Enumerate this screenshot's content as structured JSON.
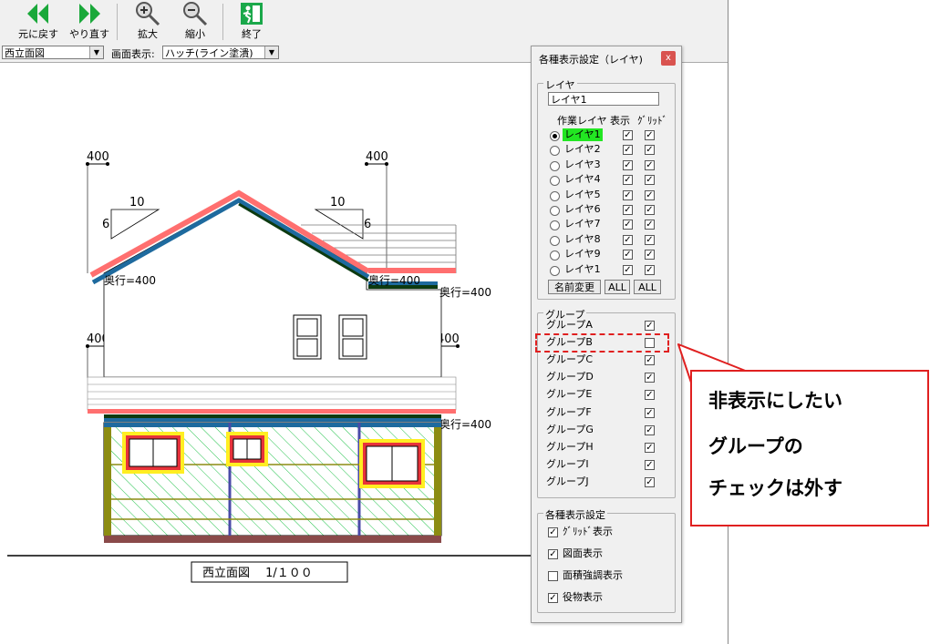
{
  "toolbar": {
    "undo_label": "元に戻す",
    "redo_label": "やり直す",
    "zoom_in_label": "拡大",
    "zoom_out_label": "縮小",
    "exit_label": "終了",
    "undo_icon": "double-left-arrow-icon",
    "redo_icon": "double-right-arrow-icon",
    "zoom_in_icon": "magnifier-plus-icon",
    "zoom_out_icon": "magnifier-minus-icon",
    "exit_icon": "exit-sign-icon"
  },
  "view_select": {
    "value": "西立面図"
  },
  "display_mode": {
    "label": "画面表示:",
    "value": "ハッチ(ライン塗潰)"
  },
  "drawing": {
    "dims": [
      "400",
      "400",
      "400",
      "400"
    ],
    "slope_left": {
      "run": "10",
      "rise": "6"
    },
    "slope_right": {
      "run": "10",
      "rise": "6"
    },
    "depth_labels": [
      "奥行=400",
      "奥行=400",
      "奥行=400",
      "奥行=400"
    ],
    "caption": "西立面図　 1/１００"
  },
  "panel": {
    "title": "各種表示設定（レイヤ)",
    "close": "x",
    "layer_group_label": "レイヤ",
    "layer_name_value": "レイヤ1",
    "col_work": "作業レイヤ",
    "col_show": "表示",
    "col_grid": "ｸﾞﾘｯﾄﾞ",
    "layers": [
      {
        "name": "レイヤ1",
        "active": true,
        "show": true,
        "grid": true
      },
      {
        "name": "レイヤ2",
        "active": false,
        "show": true,
        "grid": true
      },
      {
        "name": "レイヤ3",
        "active": false,
        "show": true,
        "grid": true
      },
      {
        "name": "レイヤ4",
        "active": false,
        "show": true,
        "grid": true
      },
      {
        "name": "レイヤ5",
        "active": false,
        "show": true,
        "grid": true
      },
      {
        "name": "レイヤ6",
        "active": false,
        "show": true,
        "grid": true
      },
      {
        "name": "レイヤ7",
        "active": false,
        "show": true,
        "grid": true
      },
      {
        "name": "レイヤ8",
        "active": false,
        "show": true,
        "grid": true
      },
      {
        "name": "レイヤ9",
        "active": false,
        "show": true,
        "grid": true
      },
      {
        "name": "レイヤ1",
        "active": false,
        "show": true,
        "grid": true
      }
    ],
    "rename_button": "名前変更",
    "all_show_button": "ALL",
    "all_grid_button": "ALL",
    "group_section_label": "グループ",
    "groups": [
      {
        "name": "グループA",
        "checked": true
      },
      {
        "name": "グループB",
        "checked": false
      },
      {
        "name": "グループC",
        "checked": true
      },
      {
        "name": "グループD",
        "checked": true
      },
      {
        "name": "グループE",
        "checked": true
      },
      {
        "name": "グループF",
        "checked": true
      },
      {
        "name": "グループG",
        "checked": true
      },
      {
        "name": "グループH",
        "checked": true
      },
      {
        "name": "グループI",
        "checked": true
      },
      {
        "name": "グループJ",
        "checked": true
      }
    ],
    "settings_label": "各種表示設定",
    "settings": [
      {
        "name": "ｸﾞﾘｯﾄﾞ表示",
        "checked": true
      },
      {
        "name": "図面表示",
        "checked": true
      },
      {
        "name": "面積強調表示",
        "checked": false
      },
      {
        "name": "役物表示",
        "checked": true
      }
    ]
  },
  "callout": {
    "lines": [
      "非表示にしたい",
      "グループの",
      "チェックは外す"
    ],
    "color": "#e02020"
  }
}
